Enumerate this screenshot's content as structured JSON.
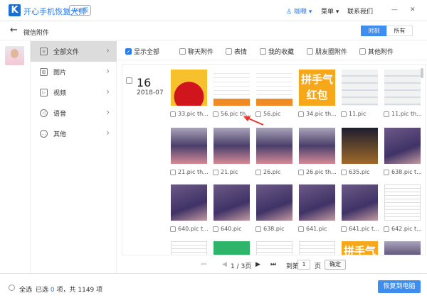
{
  "app": {
    "logo_letter": "K",
    "title": "开心手机恢复大师",
    "edition": "Win版",
    "user": "咖喱",
    "menu": "菜单",
    "contact": "联系我们",
    "minimize": "—",
    "close": "✕"
  },
  "subheader": {
    "title": "微信附件",
    "view_tabs": [
      {
        "label": "时刻",
        "active": true
      },
      {
        "label": "所有",
        "active": false
      }
    ]
  },
  "sidebar": {
    "items": [
      {
        "label": "全部文件",
        "icon": "≡"
      },
      {
        "label": "图片",
        "icon": "▨"
      },
      {
        "label": "视频",
        "icon": "▷"
      },
      {
        "label": "语音",
        "icon": "◁"
      },
      {
        "label": "其他",
        "icon": "…"
      }
    ]
  },
  "filters": [
    {
      "label": "显示全部",
      "checked": true
    },
    {
      "label": "聊天附件",
      "checked": false
    },
    {
      "label": "表情",
      "checked": false
    },
    {
      "label": "我的收藏",
      "checked": false
    },
    {
      "label": "朋友圈附件",
      "checked": false
    },
    {
      "label": "其他附件",
      "checked": false
    }
  ],
  "group": {
    "day": "16",
    "month": "2018-07"
  },
  "thumb_text": {
    "yellow": "拼手气红包"
  },
  "rows": [
    [
      {
        "name": "33.pic th...",
        "kind": "redpacket"
      },
      {
        "name": "56.pic th...",
        "kind": "screenshot"
      },
      {
        "name": "56.pic",
        "kind": "screenshot"
      },
      {
        "name": "34.pic th...",
        "kind": "yellow"
      },
      {
        "name": "11.pic",
        "kind": "chat"
      },
      {
        "name": "11.pic th...",
        "kind": "chat"
      }
    ],
    [
      {
        "name": "21.pic th...",
        "kind": "photo"
      },
      {
        "name": "21.pic",
        "kind": "photo"
      },
      {
        "name": "26.pic",
        "kind": "photo"
      },
      {
        "name": "26.pic th...",
        "kind": "photo"
      },
      {
        "name": "635.pic",
        "kind": "dark"
      },
      {
        "name": "638.pic t...",
        "kind": "purple"
      }
    ],
    [
      {
        "name": "640.pic t...",
        "kind": "purple"
      },
      {
        "name": "640.pic",
        "kind": "purple"
      },
      {
        "name": "638.pic",
        "kind": "purple"
      },
      {
        "name": "641.pic",
        "kind": "purple"
      },
      {
        "name": "641.pic t...",
        "kind": "purple"
      },
      {
        "name": "642.pic t...",
        "kind": "doc"
      }
    ],
    [
      {
        "name": "",
        "kind": "doc"
      },
      {
        "name": "",
        "kind": "green"
      },
      {
        "name": "",
        "kind": "doc"
      },
      {
        "name": "",
        "kind": "doc"
      },
      {
        "name": "",
        "kind": "yellow"
      },
      {
        "name": "",
        "kind": "photo"
      }
    ]
  ],
  "pager": {
    "current": "1 / 3页",
    "goto_prefix": "到第",
    "page_value": "1",
    "goto_suffix": "页",
    "confirm": "确定"
  },
  "footer": {
    "select_all": "全选",
    "selected_prefix": "已选",
    "selected_count": "0",
    "selected_suffix": "项，共 1149 项",
    "restore": "恢复到电脑"
  },
  "colors": {
    "accent": "#2b7de9",
    "arrow": "#e8332a"
  }
}
